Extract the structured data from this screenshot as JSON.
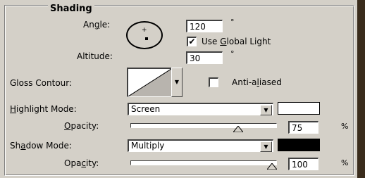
{
  "group": {
    "title": "Shading"
  },
  "angle": {
    "label_pre": "An",
    "label_ul": "g",
    "label_post": "le:",
    "value": "120",
    "unit": "°"
  },
  "global_light": {
    "checked": true,
    "check_glyph": "✔",
    "label_pre": "Use ",
    "label_ul": "G",
    "label_post": "lobal Light"
  },
  "altitude": {
    "label": "Altitude:",
    "value": "30",
    "unit": "°"
  },
  "gloss_contour": {
    "label": "Gloss Contour:"
  },
  "anti_aliased": {
    "checked": false,
    "label_pre": "Anti-a",
    "label_ul": "l",
    "label_post": "iased"
  },
  "highlight": {
    "mode_label_ul": "H",
    "mode_label_post": "ighlight Mode:",
    "mode_value": "Screen",
    "color": "#ffffff",
    "opacity_label_ul": "O",
    "opacity_label_post": "pacity:",
    "opacity_value": "75",
    "opacity_unit": "%"
  },
  "shadow": {
    "mode_label_pre": "Sh",
    "mode_label_ul": "a",
    "mode_label_post": "dow Mode:",
    "mode_value": "Multiply",
    "color": "#000000",
    "opacity_label_pre": "Opa",
    "opacity_label_ul": "c",
    "opacity_label_post": "ity:",
    "opacity_value": "100",
    "opacity_unit": "%"
  }
}
